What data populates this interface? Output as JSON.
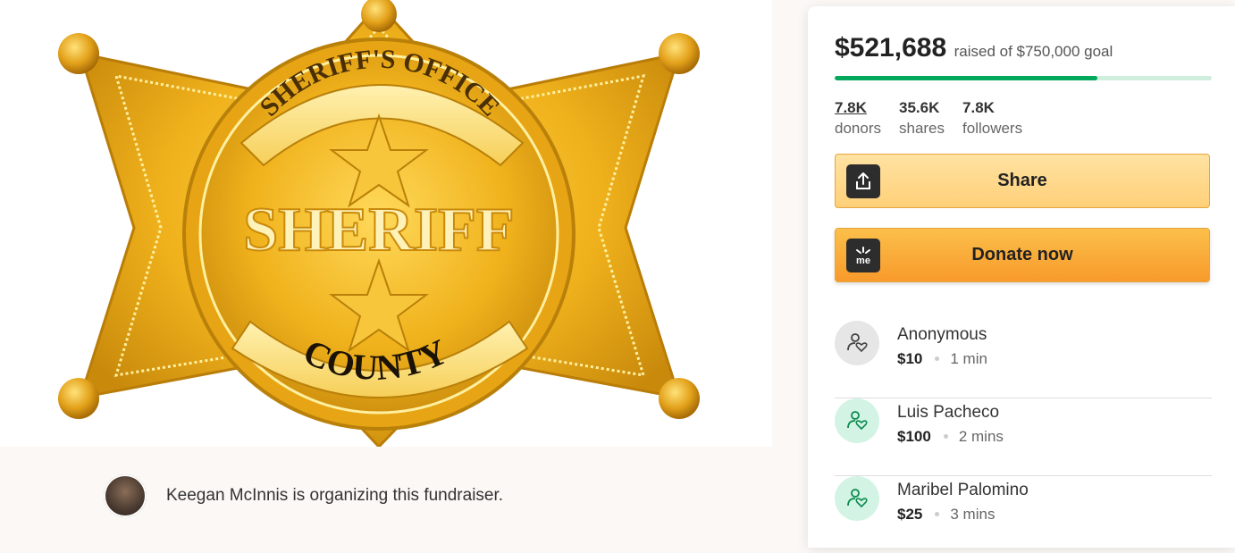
{
  "hero": {
    "image_name": "sheriff-badge",
    "badge_top_text": "SHERIFF'S OFFICE",
    "badge_center_text": "SHERIFF",
    "badge_bottom_text": "COUNTY"
  },
  "organizer": {
    "text": "Keegan McInnis is organizing this fundraiser."
  },
  "campaign": {
    "raised": "$521,688",
    "goal_text": "raised of $750,000 goal",
    "progress_fraction": 0.6956,
    "stats": [
      {
        "value": "7.8K",
        "label": "donors"
      },
      {
        "value": "35.6K",
        "label": "shares"
      },
      {
        "value": "7.8K",
        "label": "followers"
      }
    ]
  },
  "buttons": {
    "share": "Share",
    "donate": "Donate now",
    "donate_icon_text": "me"
  },
  "donations": [
    {
      "name": "Anonymous",
      "amount": "$10",
      "time": "1 min"
    },
    {
      "name": "Luis Pacheco",
      "amount": "$100",
      "time": "2 mins"
    },
    {
      "name": "Maribel Palomino",
      "amount": "$25",
      "time": "3 mins"
    }
  ],
  "colors": {
    "progress": "#02a95c",
    "progress_track": "#cfeedd",
    "donate_button": "#f79a2b",
    "share_button": "#ffd079",
    "badge_gold": "#f2b318"
  }
}
